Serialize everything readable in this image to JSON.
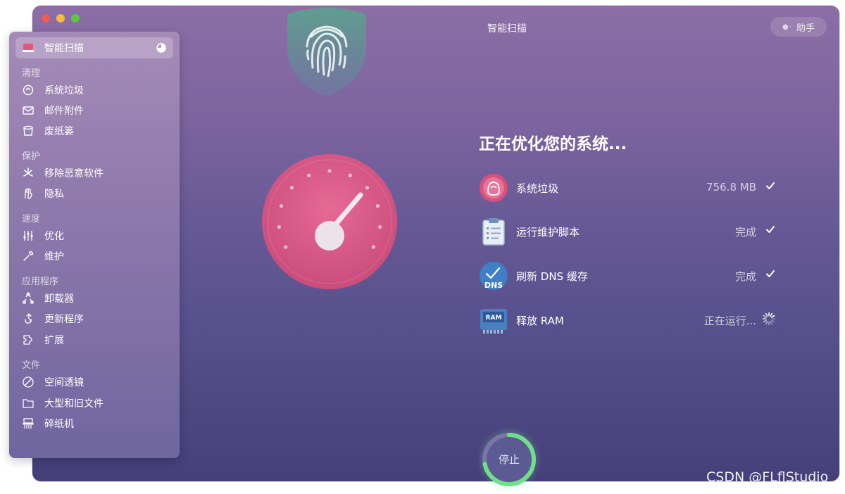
{
  "window": {
    "title": "智能扫描",
    "assistant_label": "助手"
  },
  "sidebar": {
    "active": {
      "label": "智能扫描",
      "icon": "smart-scan-icon"
    },
    "sections": [
      {
        "title": "清理",
        "items": [
          {
            "label": "系统垃圾",
            "icon": "system-junk-icon"
          },
          {
            "label": "邮件附件",
            "icon": "mail-attachments-icon"
          },
          {
            "label": "废纸篓",
            "icon": "trash-bins-icon"
          }
        ]
      },
      {
        "title": "保护",
        "items": [
          {
            "label": "移除恶意软件",
            "icon": "malware-removal-icon"
          },
          {
            "label": "隐私",
            "icon": "privacy-icon"
          }
        ]
      },
      {
        "title": "速度",
        "items": [
          {
            "label": "优化",
            "icon": "optimization-icon"
          },
          {
            "label": "维护",
            "icon": "maintenance-icon"
          }
        ]
      },
      {
        "title": "应用程序",
        "items": [
          {
            "label": "卸载器",
            "icon": "uninstaller-icon"
          },
          {
            "label": "更新程序",
            "icon": "updater-icon"
          },
          {
            "label": "扩展",
            "icon": "extensions-icon"
          }
        ]
      },
      {
        "title": "文件",
        "items": [
          {
            "label": "空间透镜",
            "icon": "space-lens-icon"
          },
          {
            "label": "大型和旧文件",
            "icon": "large-old-files-icon"
          },
          {
            "label": "碎纸机",
            "icon": "shredder-icon"
          }
        ]
      }
    ]
  },
  "main": {
    "heading": "正在优化您的系统...",
    "tasks": [
      {
        "name": "系统垃圾",
        "status": "756.8 MB",
        "state": "done",
        "icon": "system-junk-task-icon"
      },
      {
        "name": "运行维护脚本",
        "status": "完成",
        "state": "done",
        "icon": "maintenance-scripts-icon"
      },
      {
        "name": "刷新 DNS 缓存",
        "status": "完成",
        "state": "done",
        "icon": "dns-cache-icon",
        "icon_text": "DNS"
      },
      {
        "name": "释放 RAM",
        "status": "正在运行...",
        "state": "running",
        "icon": "ram-icon",
        "icon_text": "RAM"
      }
    ],
    "stop_label": "停止",
    "progress": 0.72
  },
  "colors": {
    "gauge": "#d95a86",
    "progress_ring": "#6fe08a",
    "shield": "#5f9d8f"
  },
  "watermark": "CSDN @FLflStudio"
}
